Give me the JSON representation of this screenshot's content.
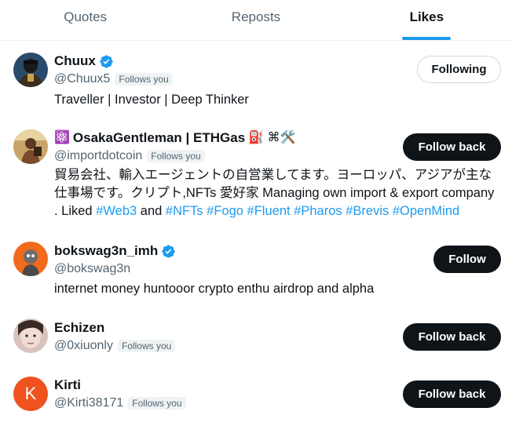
{
  "tabs": [
    {
      "label": "Quotes",
      "active": false
    },
    {
      "label": "Reposts",
      "active": false
    },
    {
      "label": "Likes",
      "active": true
    }
  ],
  "colors": {
    "accent": "#1d9bf0",
    "text": "#0f1419",
    "muted": "#536471",
    "button_dark": "#0f1419"
  },
  "users": [
    {
      "name": "Chuux",
      "verified": true,
      "handle": "@Chuux5",
      "follows_you": "Follows you",
      "bio": "Traveller | Investor | Deep Thinker",
      "button": "Following",
      "avatar_icon": "avatar-figure-dark"
    },
    {
      "name": "OsakaGentleman | ETHGas",
      "name_prefix_emoji": "⚛️",
      "name_suffix_emoji": "⛽ ⌘🛠️",
      "verified": false,
      "handle": "@importdotcoin",
      "follows_you": "Follows you",
      "bio_text_1": "貿易会社、輸入エージェントの自営業してます。ヨーロッパ、アジアが主な仕事場です。クリプト,NFTs 愛好家 Managing own import & export company . Liked ",
      "bio_tag_1": "#Web3",
      "bio_text_2": " and ",
      "bio_tags": [
        "#NFTs",
        "#Fogo",
        "#Fluent",
        "#Pharos",
        "#Brevis",
        "#OpenMind"
      ],
      "button": "Follow back",
      "avatar_icon": "avatar-photo-tan"
    },
    {
      "name": "bokswag3n_imh",
      "verified": true,
      "handle": "@bokswag3n",
      "follows_you": "",
      "bio": "internet money huntooor crypto enthu airdrop and alpha",
      "button": "Follow",
      "avatar_icon": "avatar-orange-character"
    },
    {
      "name": "Echizen",
      "verified": false,
      "handle": "@0xiuonly",
      "follows_you": "Follows you",
      "bio": "",
      "button": "Follow back",
      "avatar_icon": "avatar-photo-face"
    },
    {
      "name": "Kirti",
      "verified": false,
      "handle": "@Kirti38171",
      "follows_you": "Follows you",
      "bio": "",
      "button": "Follow back",
      "avatar_letter": "K"
    }
  ]
}
